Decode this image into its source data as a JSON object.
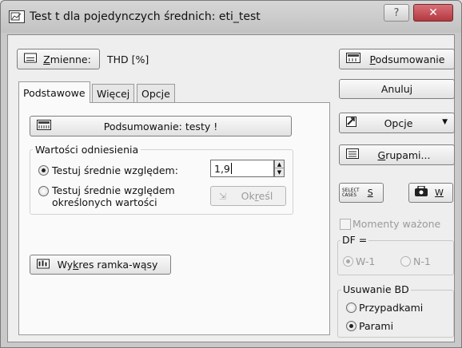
{
  "window": {
    "title": "Test t dla pojedynczych średnich: eti_test",
    "help_glyph": "?",
    "close_glyph": "✕"
  },
  "variables": {
    "button_label_prefix": "Z",
    "button_label_rest": "mienne:",
    "value": "THD [%]"
  },
  "tabs": [
    {
      "label": "Podstawowe",
      "active": true
    },
    {
      "label": "Więcej",
      "active": false
    },
    {
      "label": "Opcje",
      "active": false
    }
  ],
  "main": {
    "summary_tests_button": "Podsumowanie: testy !",
    "reference_group_label": "Wartości odniesienia",
    "radio_test_vs_label": "Testuj średnie względem:",
    "reference_value": "1,9",
    "radio_test_specified_label_line1": "Testuj średnie względem",
    "radio_test_specified_label_line2": "określonych wartości",
    "specify_button_prefix": "Ok",
    "specify_button_u": "r",
    "specify_button_rest": "eśl",
    "boxplot_button_prefix": "Wy",
    "boxplot_button_u": "k",
    "boxplot_button_rest": "res ramka-wąsy"
  },
  "right": {
    "summary_button_u": "P",
    "summary_button_rest": "odsumowanie",
    "cancel_button": "Anuluj",
    "options_button": "Opcje",
    "groups_button_u": "G",
    "groups_button_rest": "rupami...",
    "select_cases_icon_line1": "SELECT",
    "select_cases_icon_line2": "CASES",
    "select_cases_key": "S",
    "weights_key": "W",
    "weighted_moments_label": "Momenty ważone",
    "df_label": "DF =",
    "df_w1": "W-1",
    "df_n1": "N-1",
    "missing_label": "Usuwanie BD",
    "casewise": "Przypadkami",
    "pairwise": "Parami"
  },
  "colors": {
    "close_button": "#c8414a",
    "background": "#eeeeee"
  }
}
